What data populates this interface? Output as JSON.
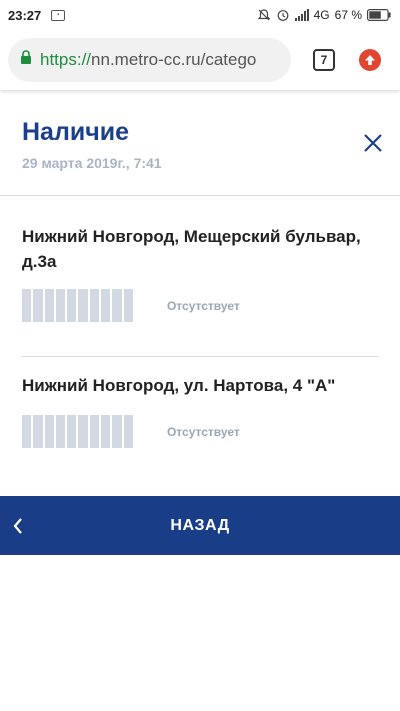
{
  "status_bar": {
    "time": "23:27",
    "network": "4G",
    "battery": "67 %",
    "icons": [
      "notification-icon",
      "dnd-icon",
      "alarm-icon",
      "signal-icon",
      "battery-icon"
    ]
  },
  "browser": {
    "url_scheme": "https://",
    "url_rest": "nn.metro-cc.ru/catego",
    "tab_count": "7",
    "icons": [
      "lock-icon",
      "update-icon"
    ]
  },
  "modal": {
    "title": "Наличие",
    "date": "29 марта 2019г., 7:41",
    "stores": [
      {
        "name": "Нижний Новгород, Мещерский бульвар, д.3а",
        "status": "Отсутствует",
        "level": 0
      },
      {
        "name": "Нижний Новгород, ул. Нартова, 4 \"А\"",
        "status": "Отсутствует",
        "level": 0
      }
    ],
    "back_label": "НАЗАД"
  },
  "colors": {
    "brand_blue": "#1a3d87",
    "title_blue": "#1c3f8c",
    "bar_empty": "#d2d9e3",
    "update_red": "#e0452f",
    "url_green": "#1e8e3e"
  }
}
